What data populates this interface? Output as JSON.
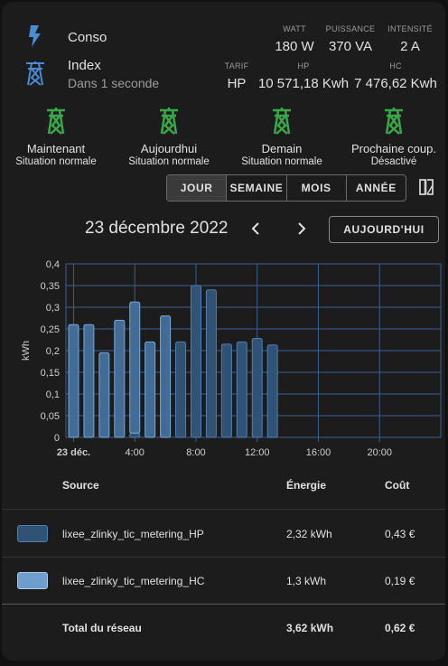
{
  "header": {
    "conso_label": "Conso",
    "index_label": "Index",
    "index_sub": "Dans 1 seconde",
    "watt_hdr": "WATT",
    "puissance_hdr": "PUISSANCE",
    "intensite_hdr": "INTENSITÉ",
    "watt_val": "180 W",
    "puissance_val": "370 VA",
    "intensite_val": "2 A",
    "tarif_hdr": "TARIF",
    "hp_hdr": "HP",
    "hc_hdr": "HC",
    "tarif_val": "HP",
    "hp_val": "10 571,18 Kwh",
    "hc_val": "7 476,62 Kwh"
  },
  "status": [
    {
      "title": "Maintenant",
      "sub": "Situation normale"
    },
    {
      "title": "Aujourdhui",
      "sub": "Situation normale"
    },
    {
      "title": "Demain",
      "sub": "Situation normale"
    },
    {
      "title": "Prochaine coup.",
      "sub": "Désactivé"
    }
  ],
  "tabs": {
    "jour": "JOUR",
    "semaine": "SEMAINE",
    "mois": "MOIS",
    "annee": "ANNÉE"
  },
  "date_label": "23 décembre 2022",
  "today_button": "AUJOURD'HUI",
  "colors": {
    "green": "#3aa84a",
    "blue_icon": "#4a8bd8",
    "bar_hp": "#3d6a95",
    "bar_hc": "#7aa8d6"
  },
  "chart_data": {
    "type": "bar",
    "ylabel": "kWh",
    "ylim": [
      0,
      0.4
    ],
    "yticks": [
      "0",
      "0,05",
      "0,1",
      "0,15",
      "0,2",
      "0,25",
      "0,3",
      "0,35",
      "0,4"
    ],
    "xticks": [
      {
        "label": "23 déc.",
        "hour": 0
      },
      {
        "label": "4:00",
        "hour": 4
      },
      {
        "label": "8:00",
        "hour": 8
      },
      {
        "label": "12:00",
        "hour": 12
      },
      {
        "label": "16:00",
        "hour": 16
      },
      {
        "label": "20:00",
        "hour": 20
      }
    ],
    "x_hours_range": [
      -0.5,
      24
    ],
    "hours": [
      0,
      1,
      2,
      3,
      4,
      5,
      6,
      7,
      8,
      9,
      10,
      11,
      12,
      13
    ],
    "series": [
      {
        "name": "lixee_zlinky_tic_metering_HP",
        "values": [
          0,
          0,
          0,
          0,
          0.01,
          0,
          0,
          0.22,
          0.35,
          0.34,
          0.215,
          0.22,
          0.228,
          0.213
        ]
      },
      {
        "name": "lixee_zlinky_tic_metering_HC",
        "values": [
          0.26,
          0.26,
          0.195,
          0.27,
          0.302,
          0.22,
          0.28,
          0,
          0,
          0,
          0,
          0,
          0,
          0
        ]
      }
    ]
  },
  "table": {
    "headers": {
      "source": "Source",
      "energie": "Énergie",
      "cout": "Coût"
    },
    "rows": [
      {
        "source": "lixee_zlinky_tic_metering_HP",
        "energie": "2,32 kWh",
        "cout": "0,43 €"
      },
      {
        "source": "lixee_zlinky_tic_metering_HC",
        "energie": "1,3 kWh",
        "cout": "0,19 €"
      }
    ],
    "total": {
      "label": "Total du réseau",
      "energie": "3,62 kWh",
      "cout": "0,62 €"
    }
  }
}
